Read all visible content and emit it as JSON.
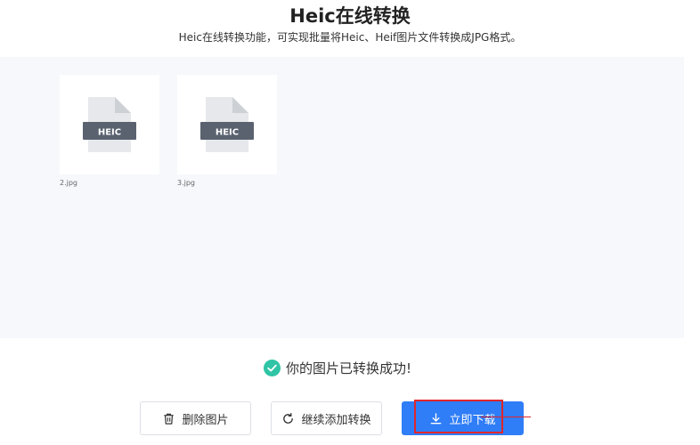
{
  "header": {
    "title": "Heic在线转换",
    "subtitle": "Heic在线转换功能，可实现批量将Heic、Heif图片文件转换成JPG格式。"
  },
  "files": [
    {
      "name": "2.jpg",
      "badge": "HEIC"
    },
    {
      "name": "3.jpg",
      "badge": "HEIC"
    }
  ],
  "status": {
    "message": "你的图片已转换成功!",
    "color": "#2ec4a5"
  },
  "actions": {
    "delete_label": "删除图片",
    "continue_label": "继续添加转换",
    "download_label": "立即下载"
  },
  "colors": {
    "primary": "#2f7df7",
    "highlight": "#e0262b",
    "badge": "#5a6270"
  }
}
